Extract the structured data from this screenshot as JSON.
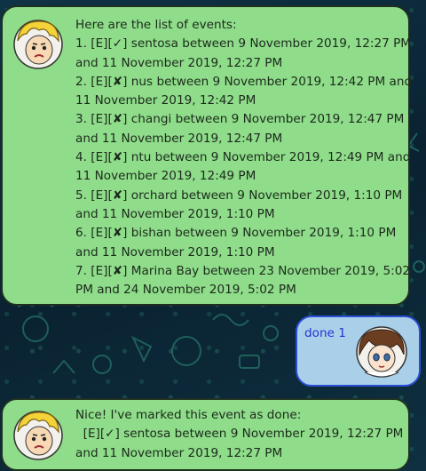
{
  "duke_list_message": {
    "lines": [
      "Here are the list of events:",
      "1. [E][✓] sentosa between 9 November 2019, 12:27 PM",
      "and 11 November 2019, 12:27 PM",
      "2. [E][✘] nus between 9 November 2019, 12:42 PM and",
      "11 November 2019, 12:42 PM",
      "3. [E][✘] changi between 9 November 2019, 12:47 PM",
      "and 11 November 2019, 12:47 PM",
      "4. [E][✘] ntu between 9 November 2019, 12:49 PM and",
      "11 November 2019, 12:49 PM",
      "5. [E][✘] orchard between 9 November 2019, 1:10 PM",
      "and 11 November 2019, 1:10 PM",
      "6. [E][✘] bishan between 9 November 2019, 1:10 PM",
      "and 11 November 2019, 1:10 PM",
      "7. [E][✘] Marina Bay between 23 November 2019, 5:02",
      "PM and 24 November 2019, 5:02 PM"
    ]
  },
  "user_message": {
    "text": "done 1"
  },
  "duke_done_message": {
    "lines": [
      "Nice! I've marked this event as done:",
      "  [E][✓] sentosa between 9 November 2019, 12:27 PM",
      "and 11 November 2019, 12:27 PM"
    ]
  },
  "colors": {
    "duke_bubble": "#8fdc8a",
    "user_bubble": "#a9cfe9",
    "user_text": "#2034d6",
    "background": "#0d2a3a"
  },
  "icons": {
    "duke_avatar": "blonde-cartoon-face-icon",
    "user_avatar": "brown-haired-anime-face-icon"
  }
}
